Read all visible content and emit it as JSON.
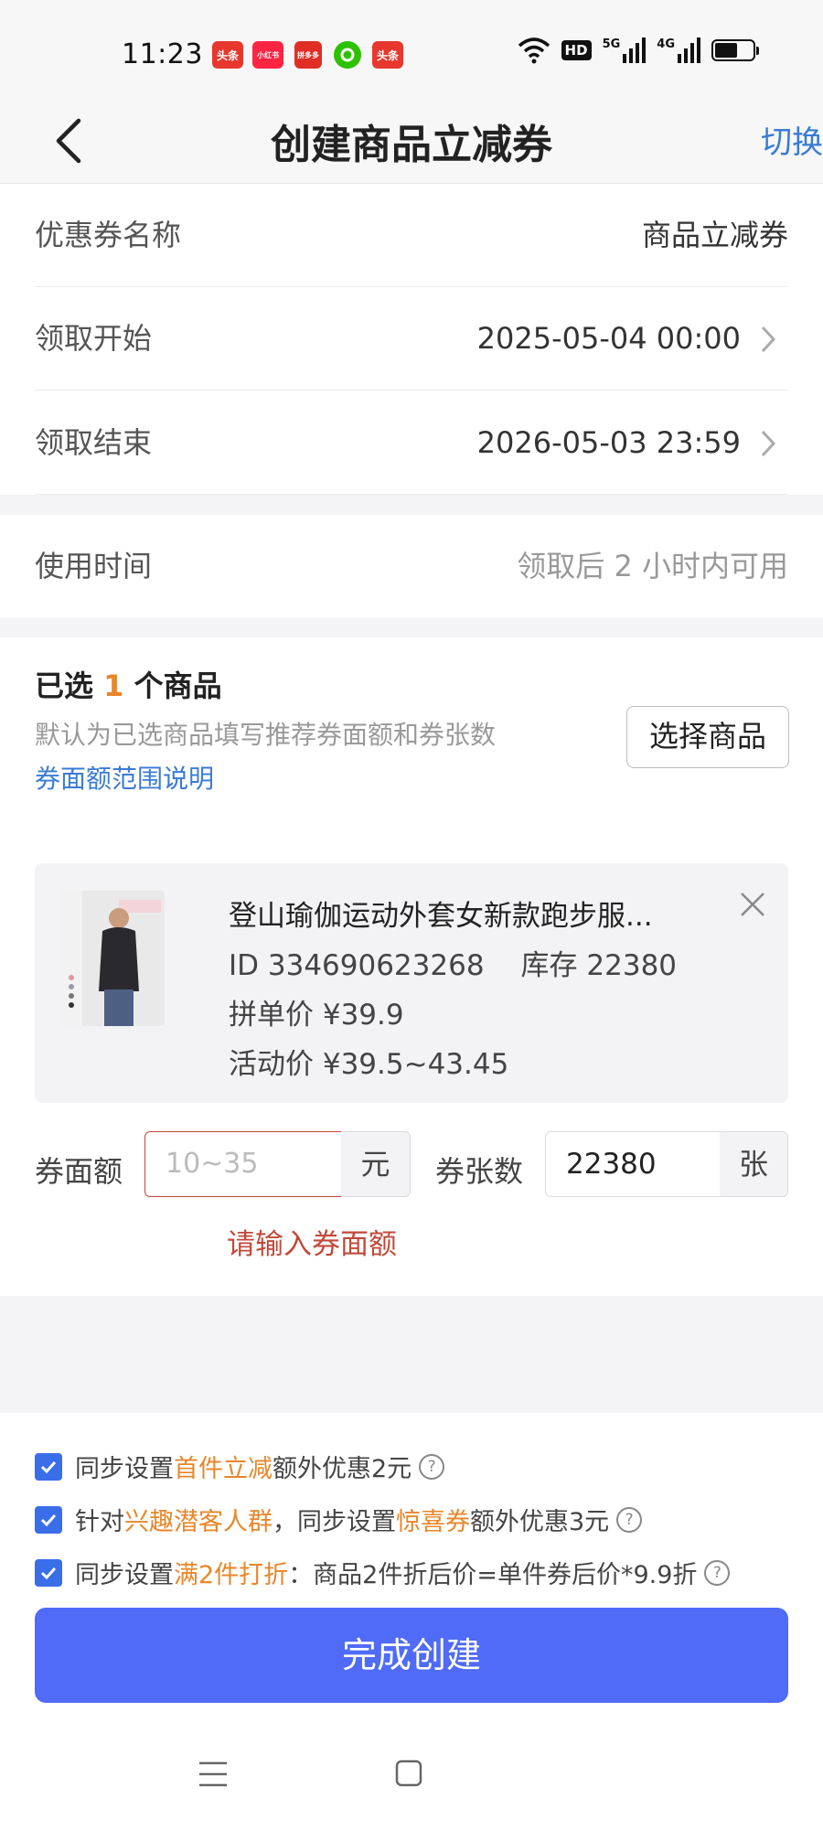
{
  "status_bar": {
    "time": "11:23",
    "apps": [
      {
        "name": "头条",
        "color": "#e8372d"
      },
      {
        "name": "小红书",
        "color": "#ff2442"
      },
      {
        "name": "拼多多",
        "color": "#e02e24"
      },
      {
        "name": "微信",
        "color": "#2dc100"
      },
      {
        "name": "头条",
        "color": "#e8372d"
      }
    ],
    "hd_label": "HD",
    "sig1_label": "5G",
    "sig2_label": "4G"
  },
  "header": {
    "title": "创建商品立减券",
    "switch_label": "切换"
  },
  "form": {
    "name_label": "优惠券名称",
    "name_value": "商品立减券",
    "start_label": "领取开始",
    "start_value": "2025-05-04 00:00",
    "end_label": "领取结束",
    "end_value": "2026-05-03 23:59",
    "usage_label": "使用时间",
    "usage_value": "领取后 2 小时内可用"
  },
  "selection": {
    "prefix": "已选",
    "count": "1",
    "suffix": "个商品",
    "desc": "默认为已选商品填写推荐券面额和券张数",
    "link": "券面额范围说明",
    "choose_button": "选择商品"
  },
  "product": {
    "name": "登山瑜伽运动外套女新款跑步服...",
    "id_line": "ID 334690623268",
    "stock_line": "库存 22380",
    "group_price": "拼单价 ¥39.9",
    "activity_price": "活动价 ¥39.5~43.45"
  },
  "coupon": {
    "amount_label": "券面额",
    "amount_placeholder": "10~35",
    "amount_unit": "元",
    "count_label": "券张数",
    "count_value": "22380",
    "count_unit": "张",
    "error": "请输入券面额"
  },
  "options": [
    {
      "a": "同步设置",
      "b": "首件立减",
      "c": "额外优惠2元",
      "d": "",
      "e": ""
    },
    {
      "a": "针对",
      "b": "兴趣潜客人群",
      "c": "，同步设置",
      "d": "惊喜券",
      "e": "额外优惠3元"
    },
    {
      "a": "同步设置",
      "b": "满2件打折",
      "c": "：商品2件折后价=单件券后价*9.9折",
      "d": "",
      "e": ""
    }
  ],
  "submit_label": "完成创建",
  "colors": {
    "accent_blue": "#4f6bf7",
    "link_blue": "#3a7bd5",
    "orange": "#e8862a",
    "error_red": "#c0493a"
  }
}
